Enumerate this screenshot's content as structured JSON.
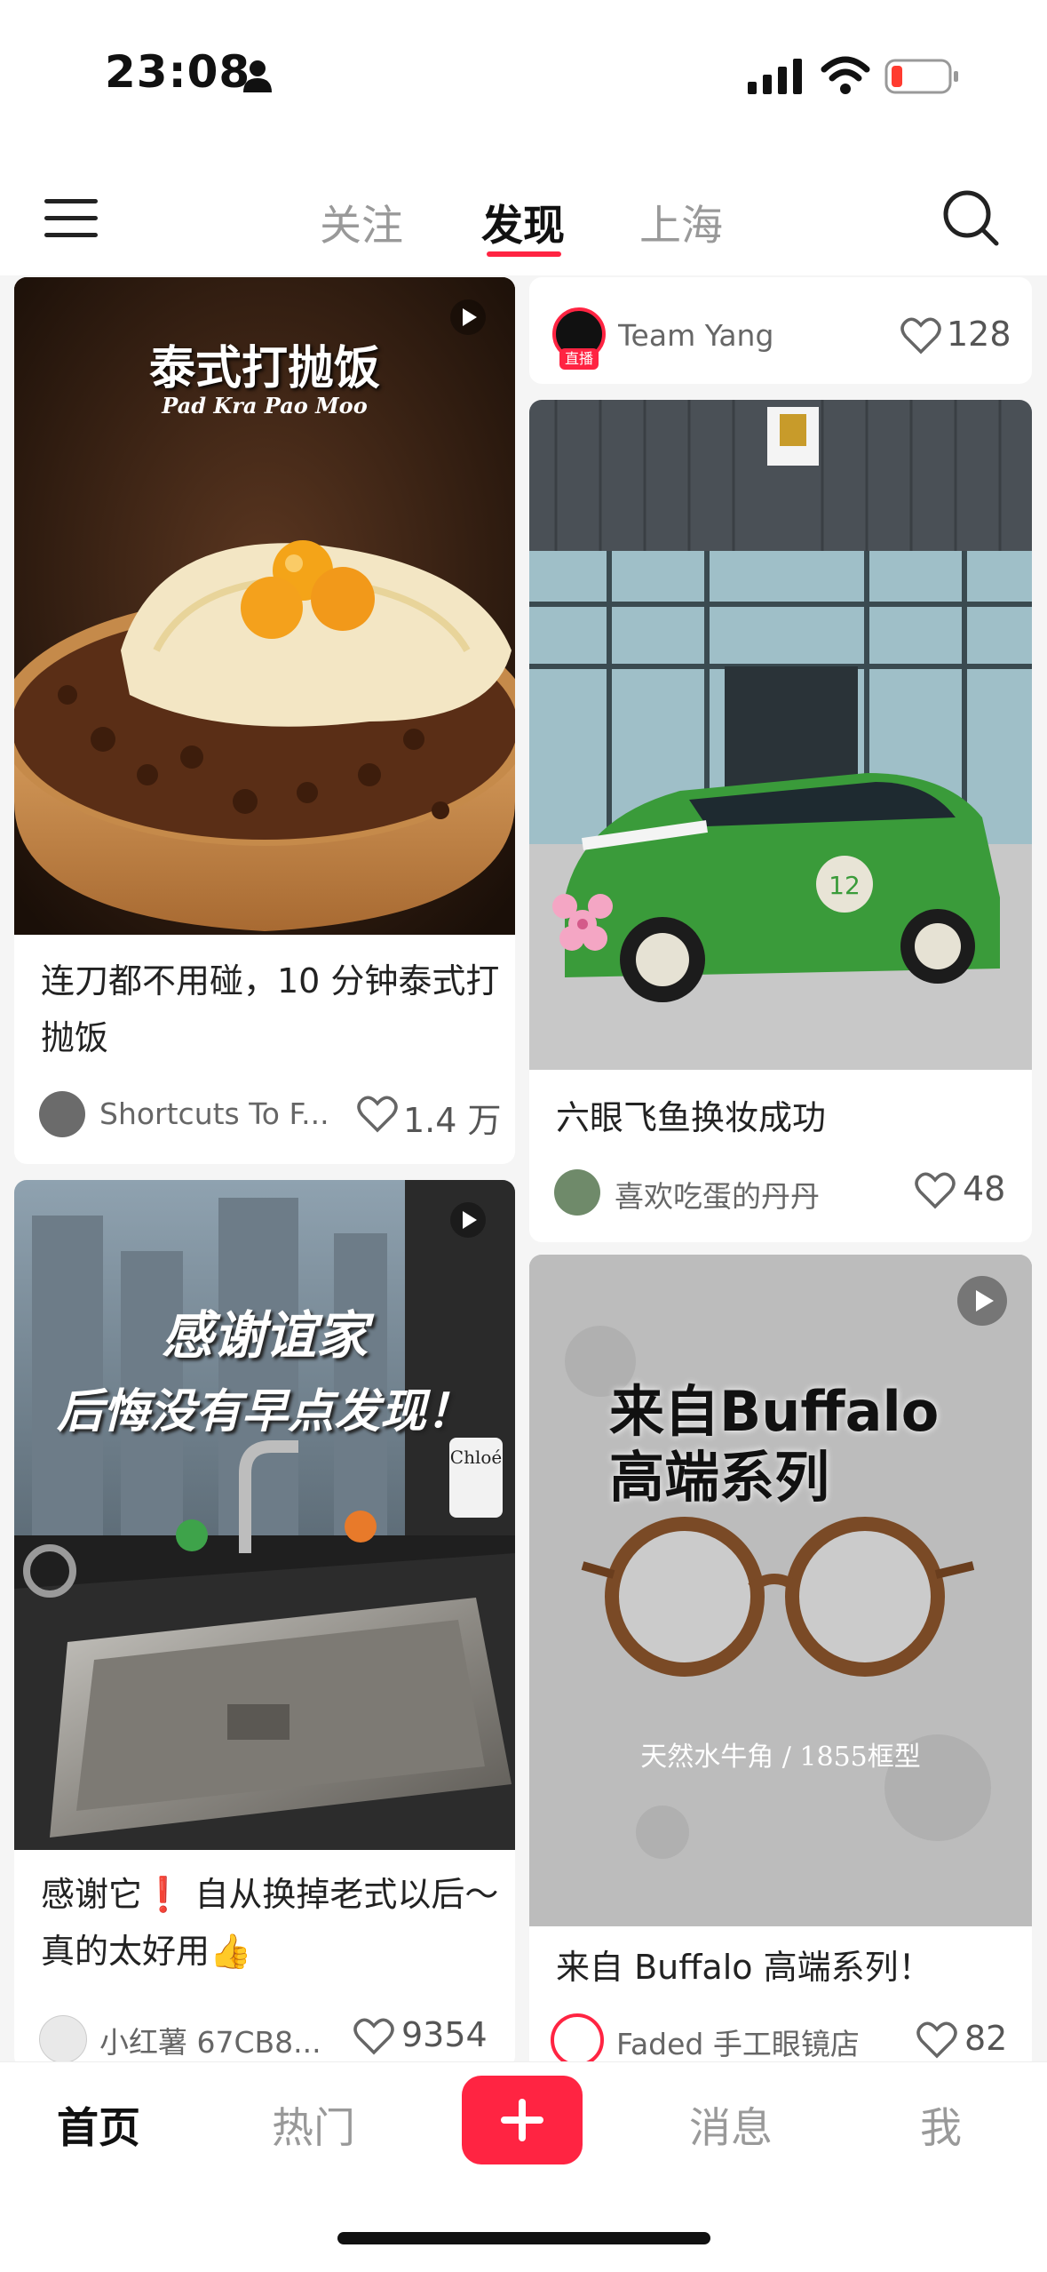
{
  "status_bar": {
    "time": "23:08",
    "battery_color": "#ff3b30"
  },
  "header": {
    "tabs": [
      {
        "label": "关注",
        "active": false
      },
      {
        "label": "发现",
        "active": true
      },
      {
        "label": "上海",
        "active": false
      }
    ],
    "accent_color": "#ff2442"
  },
  "feed": {
    "left": [
      {
        "cover_heading": "泰式打抛饭",
        "cover_subheading": "Pad Kra Pao Moo",
        "has_video": true,
        "title": "连刀都不用碰，10 分钟泰式打抛饭",
        "author": "Shortcuts To F...",
        "likes": "1.4 万"
      },
      {
        "cover_heading_1": "感谢谊家",
        "cover_heading_2": "后悔没有早点发现！",
        "cover_label": "Chloé",
        "has_video": true,
        "title_part1": "感谢它",
        "title_emoji": "❗",
        "title_part2": " 自从换掉老式以后～真的太好用",
        "title_emoji2": "👍",
        "author": "小红薯 67CB8...",
        "likes": "9354"
      }
    ],
    "right": [
      {
        "author": "Team Yang",
        "live_badge": "直播",
        "likes": "128"
      },
      {
        "title": "六眼飞鱼换妆成功",
        "author": "喜欢吃蛋的丹丹",
        "likes": "48",
        "car_number": "12"
      },
      {
        "cover_heading_1": "来自Buffalo",
        "cover_heading_2": "高端系列",
        "cover_caption": "天然水牛角 / 1855框型",
        "has_video": true,
        "title": "来自 Buffalo 高端系列！",
        "author": "Faded 手工眼镜店",
        "likes": "82"
      }
    ]
  },
  "bottom_nav": {
    "items": [
      "首页",
      "热门",
      "消息",
      "我"
    ],
    "plus_icon": "plus-icon"
  }
}
